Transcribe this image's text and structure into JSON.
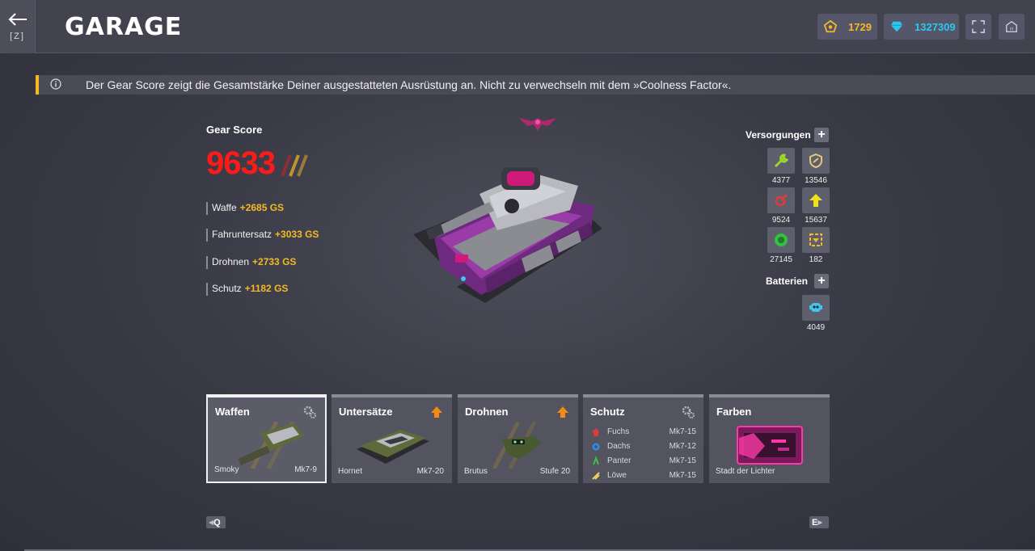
{
  "header": {
    "back_key": "[Z]",
    "title": "GARAGE",
    "crystals": "1729",
    "diamonds": "1327309",
    "icons": {
      "back": "arrow-left-icon",
      "crystal": "crystal-pentagon-icon",
      "diamond": "diamond-icon",
      "fullscreen": "fullscreen-icon",
      "home": "home-icon"
    }
  },
  "info": {
    "text": "Der Gear Score zeigt die Gesamtstärke Deiner ausgestatteten Ausrüstung an. Nicht zu verwechseln mit dem »Coolness Factor«."
  },
  "gear_score": {
    "label": "Gear Score",
    "value": "9633",
    "lines": [
      {
        "label": "Waffe",
        "bonus": "+2685 GS"
      },
      {
        "label": "Fahruntersatz",
        "bonus": "+3033 GS"
      },
      {
        "label": "Drohnen",
        "bonus": "+2733 GS"
      },
      {
        "label": "Schutz",
        "bonus": "+1182 GS"
      }
    ]
  },
  "supplies": {
    "title": "Versorgungen",
    "items": [
      {
        "icon": "repair-wrench-icon",
        "count": "4377",
        "color": "#9fd62a"
      },
      {
        "icon": "armor-shield-icon",
        "count": "13546",
        "color": "#e8c677"
      },
      {
        "icon": "damage-icon",
        "count": "9524",
        "color": "#e23a3a"
      },
      {
        "icon": "speed-arrow-icon",
        "count": "15637",
        "color": "#f0e21a"
      },
      {
        "icon": "mine-icon",
        "count": "27145",
        "color": "#34c043"
      },
      {
        "icon": "gold-box-icon",
        "count": "182",
        "color": "#f6b925"
      }
    ]
  },
  "batteries": {
    "title": "Batterien",
    "items": [
      {
        "icon": "battery-robot-icon",
        "count": "4049",
        "color": "#3fc7ef"
      }
    ]
  },
  "cards": {
    "weapons": {
      "title": "Waffen",
      "name": "Smoky",
      "level": "Mk7-9"
    },
    "hulls": {
      "title": "Untersätze",
      "name": "Hornet",
      "level": "Mk7-20"
    },
    "drones": {
      "title": "Drohnen",
      "name": "Brutus",
      "level": "Stufe 20"
    },
    "protection": {
      "title": "Schutz",
      "rows": [
        {
          "name": "Fuchs",
          "level": "Mk7-15",
          "color": "#e03a3a"
        },
        {
          "name": "Dachs",
          "level": "Mk7-12",
          "color": "#2a8ef0"
        },
        {
          "name": "Panter",
          "level": "Mk7-15",
          "color": "#3ac04a"
        },
        {
          "name": "Löwe",
          "level": "Mk7-15",
          "color": "#f0d060"
        }
      ]
    },
    "paints": {
      "title": "Farben",
      "name": "Stadt der Lichter"
    }
  },
  "nav": {
    "prev_key": "Q",
    "next_key": "E"
  },
  "colors": {
    "accent_gold": "#f6b925",
    "score_red": "#ff1a1a",
    "diamond_blue": "#2ec6f0"
  }
}
